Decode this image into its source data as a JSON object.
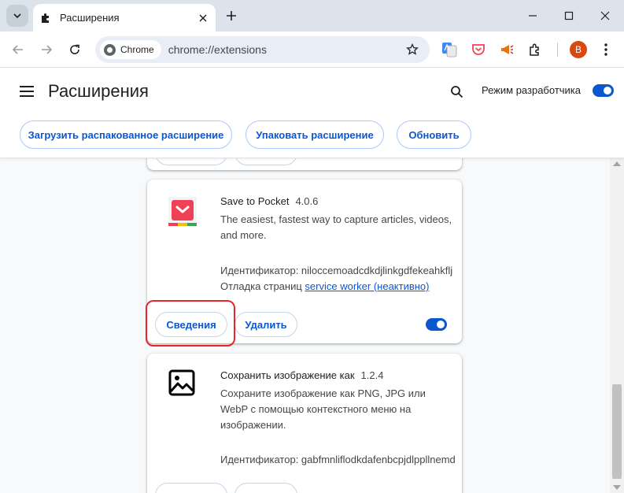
{
  "browser": {
    "tab": {
      "title": "Расширения"
    },
    "omnibox": {
      "chip": "Chrome",
      "url": "chrome://extensions"
    },
    "avatar_letter": "B"
  },
  "header": {
    "title": "Расширения",
    "dev_mode_label": "Режим разработчика",
    "dev_mode_on": true,
    "buttons": {
      "load": "Загрузить распакованное расширение",
      "pack": "Упаковать расширение",
      "update": "Обновить"
    }
  },
  "extensions": [
    {
      "name": "Save to Pocket",
      "version": "4.0.6",
      "description": "The easiest, fastest way to capture articles, videos, and more.",
      "id_text": "Идентификатор: niloccemoadcdkdjlinkgdfekeahkflj",
      "debug_label": "Отладка страниц",
      "debug_link": "service worker (неактивно)",
      "details_label": "Сведения",
      "remove_label": "Удалить",
      "enabled": true
    },
    {
      "name": "Сохранить изображение как",
      "version": "1.2.4",
      "description": "Сохраните изображение как PNG, JPG или WebP с помощью контекстного меню на изображении.",
      "id_text": "Идентификатор: gabfmnliflodkdafenbcpjdlppllnemd"
    }
  ],
  "colors": {
    "accent": "#0b57d0",
    "highlight": "#e5262b",
    "pocket": "#ef4056"
  }
}
